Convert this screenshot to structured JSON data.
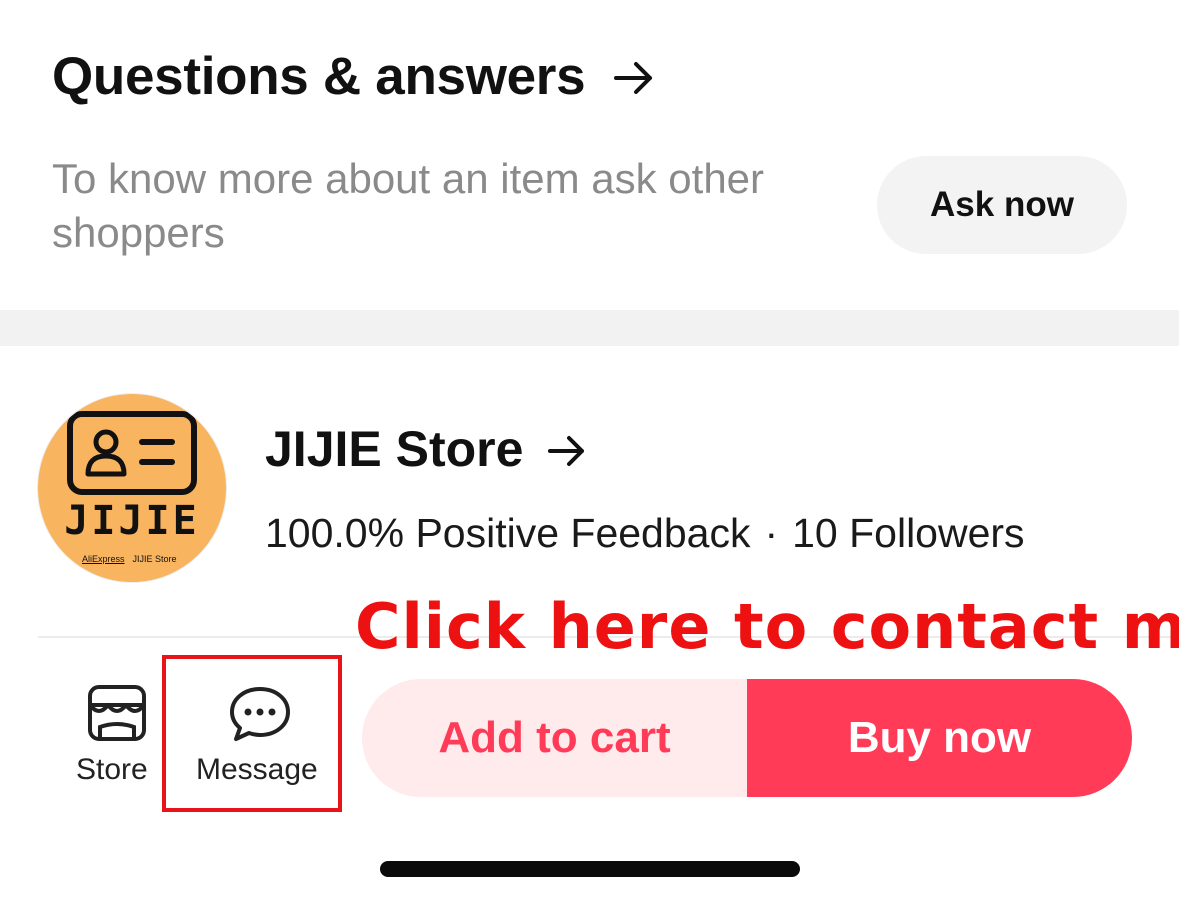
{
  "qa": {
    "title": "Questions & answers",
    "description": "To know more about an item ask other shoppers",
    "ask_button": "Ask now"
  },
  "store": {
    "name": "JIJIE Store",
    "feedback": "100.0% Positive Feedback",
    "separator": "·",
    "followers": "10 Followers",
    "logo": {
      "wordmark": "JIJIE",
      "sub_left": "AliExpress",
      "sub_right": "JIJIE Store",
      "color": "#f8b45e"
    }
  },
  "annotation": {
    "text": "Click here to contact me",
    "color": "#ee1111"
  },
  "bottom_bar": {
    "store_label": "Store",
    "message_label": "Message",
    "add_to_cart": "Add to cart",
    "buy_now": "Buy now",
    "accent_color": "#ff3b57"
  },
  "icons": {
    "qa_arrow": "arrow-right-icon",
    "store_arrow": "arrow-right-icon",
    "store_nav": "storefront-icon",
    "message_nav": "chat-bubble-icon"
  }
}
